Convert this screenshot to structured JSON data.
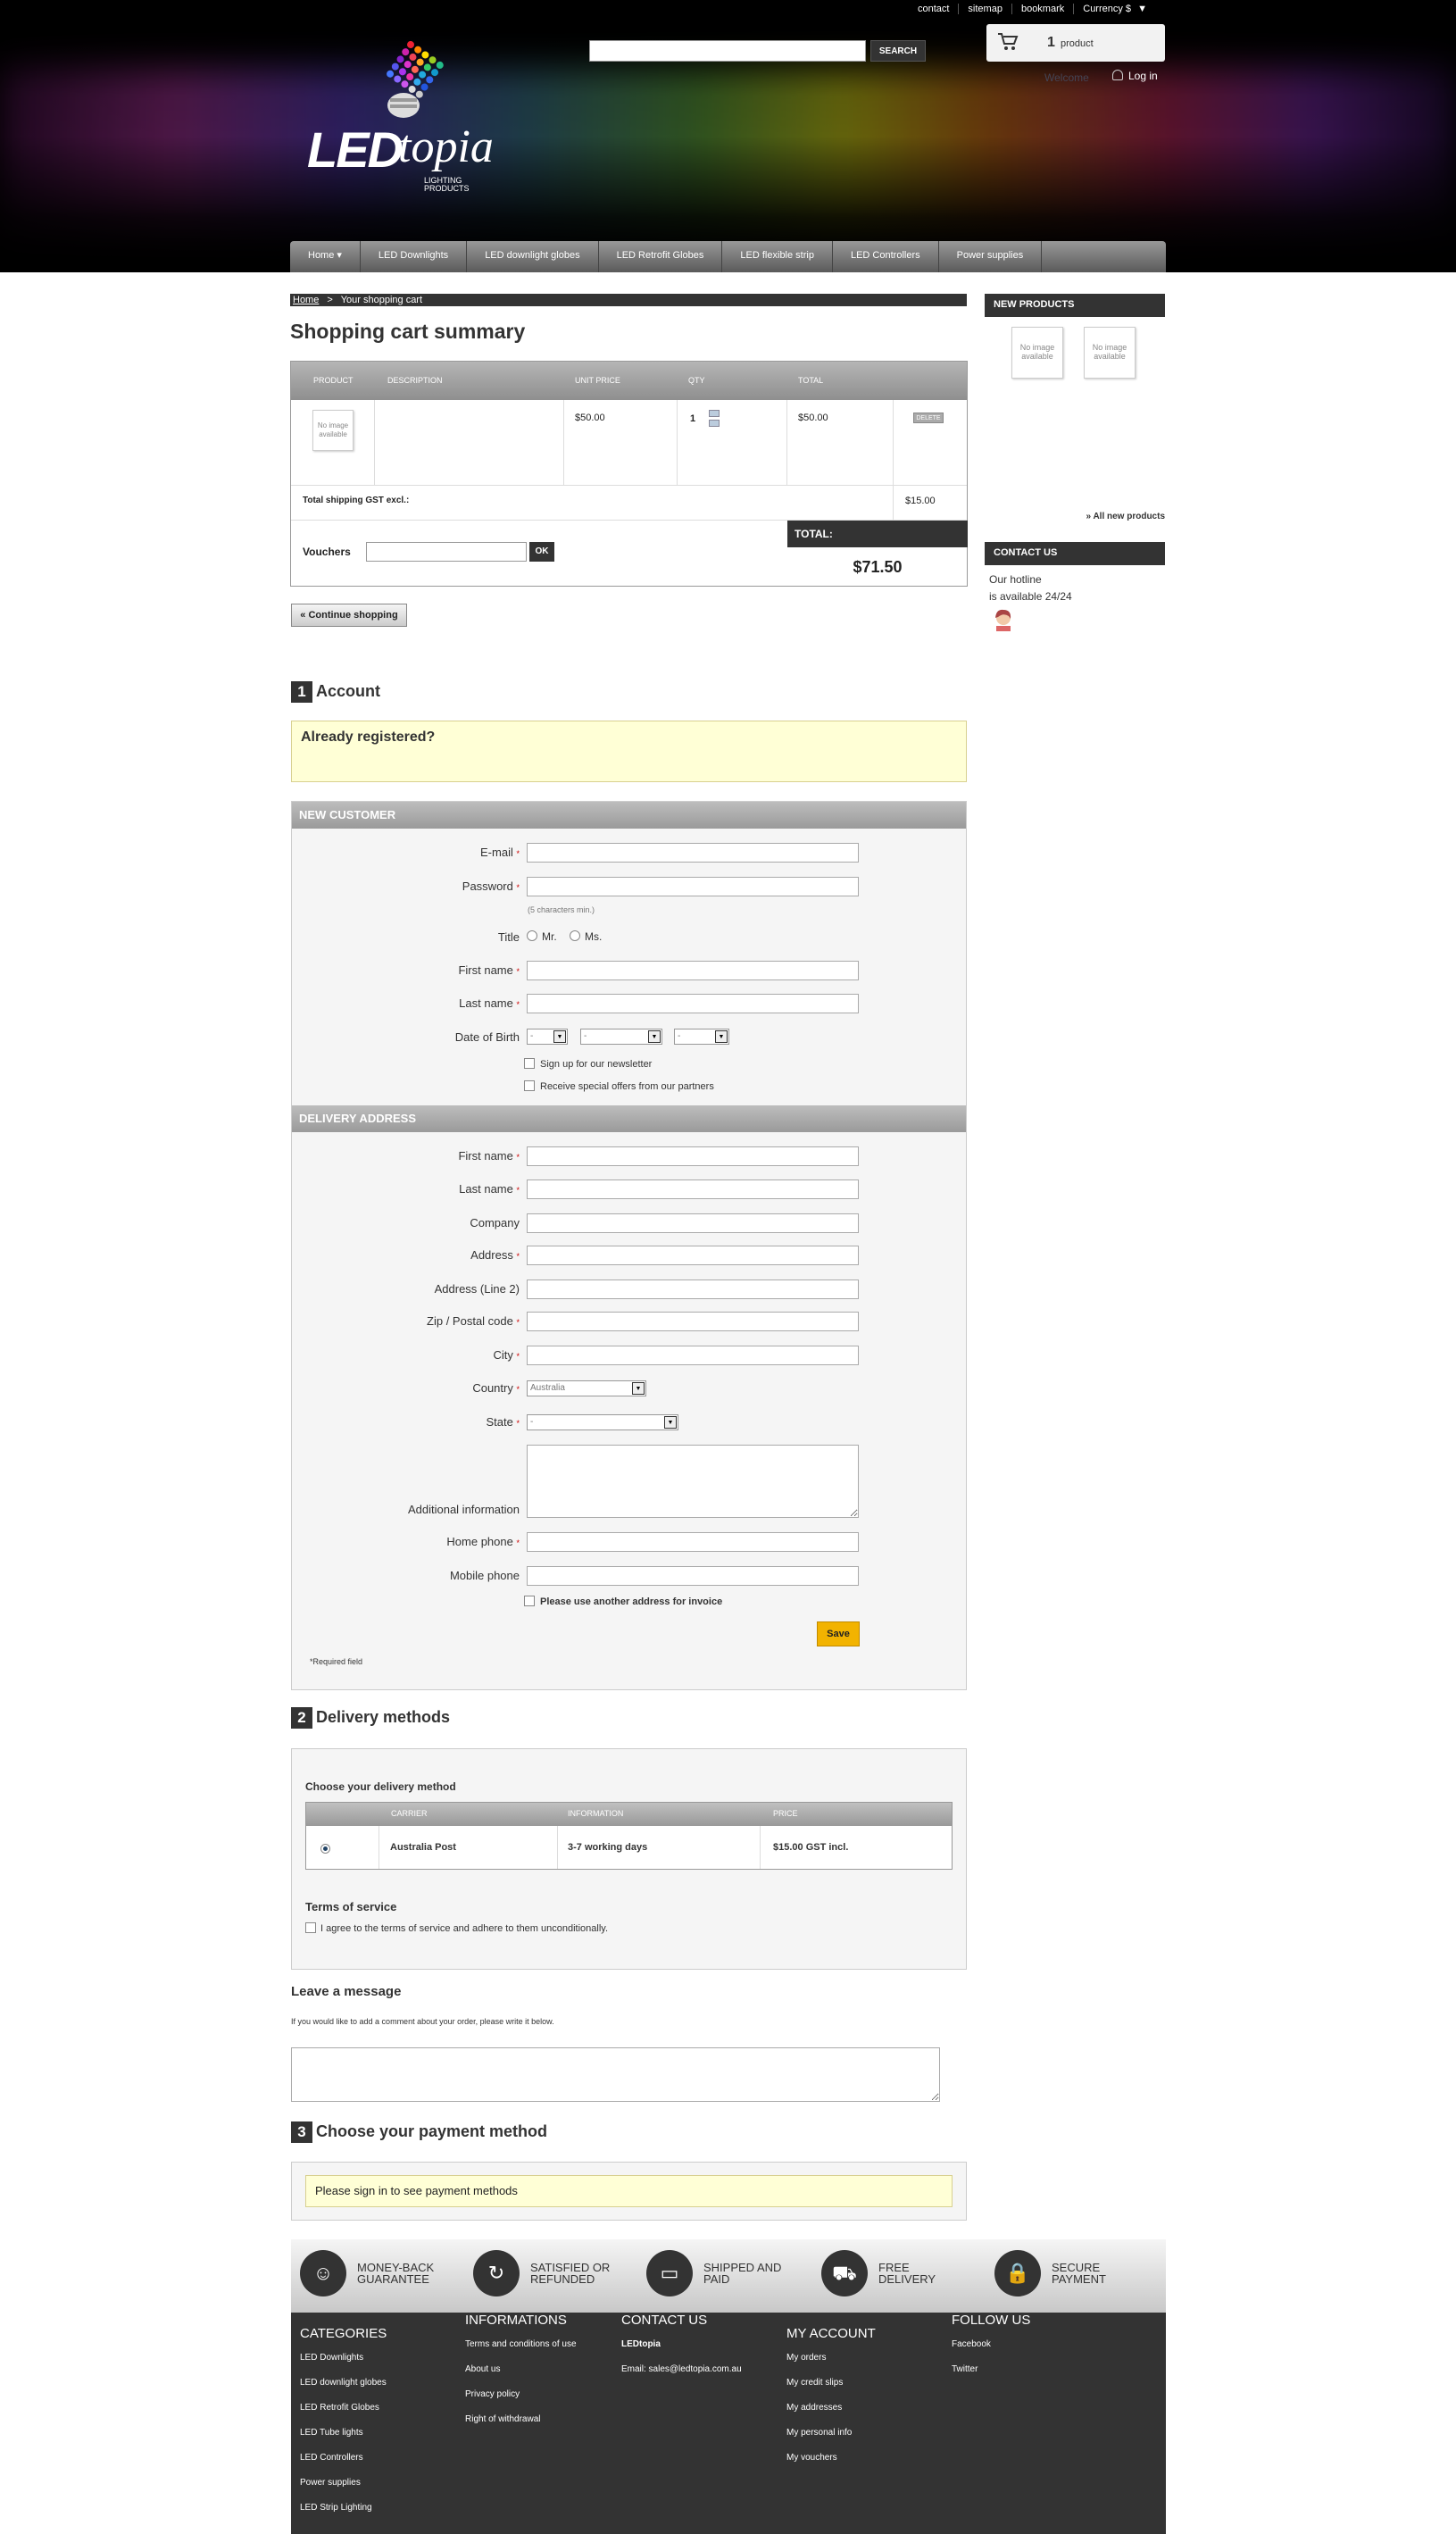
{
  "header": {
    "top_links": [
      "contact",
      "sitemap",
      "bookmark",
      "Currency $"
    ],
    "currency_arrow": "▼",
    "logo": {
      "led": "LED",
      "topia": "topia",
      "sub1": "LIGHTING",
      "sub2": "PRODUCTS"
    },
    "search": {
      "placeholder": "",
      "button": "SEARCH"
    },
    "cart": {
      "count": "1",
      "label": "product"
    },
    "welcome": "Welcome",
    "login": "Log in"
  },
  "nav": [
    "Home ▾",
    "LED Downlights",
    "LED downlight globes",
    "LED Retrofit Globes",
    "LED flexible strip",
    "LED Controllers",
    "Power supplies"
  ],
  "breadcrumb": {
    "home": "Home",
    "sep": ">",
    "current": "Your shopping cart"
  },
  "page_title": "Shopping cart summary",
  "cart_table": {
    "headers": [
      "PRODUCT",
      "DESCRIPTION",
      "UNIT PRICE",
      "QTY",
      "TOTAL"
    ],
    "row": {
      "no_image": "No image available",
      "unit_price": "$50.00",
      "qty": "1",
      "total": "$50.00",
      "delete": "DELETE"
    },
    "shipping_label": "Total shipping GST excl.:",
    "shipping_value": "$15.00",
    "vouchers_label": "Vouchers",
    "ok": "OK",
    "total_label": "TOTAL:",
    "total_value": "$71.50"
  },
  "continue_shopping": "« Continue shopping",
  "steps": {
    "account": {
      "num": "1",
      "title": "Account"
    },
    "delivery": {
      "num": "2",
      "title": "Delivery methods"
    },
    "payment": {
      "num": "3",
      "title": "Choose your payment method"
    }
  },
  "already_registered": "Already registered?",
  "new_customer": {
    "header": "NEW CUSTOMER",
    "email": "E-mail",
    "password": "Password",
    "password_hint": "(5 characters min.)",
    "title": "Title",
    "mr": "Mr.",
    "ms": "Ms.",
    "first_name": "First name",
    "last_name": "Last name",
    "dob": "Date of Birth",
    "dob_placeholder": "-",
    "newsletter": "Sign up for our newsletter",
    "offers": "Receive special offers from our partners",
    "req": "*"
  },
  "delivery_address": {
    "header": "DELIVERY ADDRESS",
    "first_name": "First name",
    "last_name": "Last name",
    "company": "Company",
    "address": "Address",
    "address2": "Address (Line 2)",
    "zip": "Zip / Postal code",
    "city": "City",
    "country": "Country",
    "country_value": "Australia",
    "state": "State",
    "state_value": "-",
    "additional": "Additional information",
    "home_phone": "Home phone",
    "mobile_phone": "Mobile phone",
    "invoice": "Please use another address for invoice",
    "save": "Save",
    "required": "*Required field"
  },
  "delivery_methods": {
    "choose": "Choose your delivery method",
    "headers": [
      "CARRIER",
      "INFORMATION",
      "PRICE"
    ],
    "carrier": "Australia Post",
    "info": "3-7 working days",
    "price": "$15.00 GST incl.",
    "terms_title": "Terms of service",
    "terms_text": "I agree to the terms of service and adhere to them unconditionally."
  },
  "message": {
    "title": "Leave a message",
    "hint": "If you would like to add a comment about your order, please write it below."
  },
  "payment_notice": "Please sign in to see payment methods",
  "sidebar": {
    "new_products": "NEW PRODUCTS",
    "no_image": "No image available",
    "all_new": "» All new products",
    "contact_us": "CONTACT US",
    "hotline1": "Our hotline",
    "hotline2": "is available 24/24"
  },
  "reassurance": [
    {
      "icon": "smile-icon",
      "text": "MONEY-BACK GUARANTEE"
    },
    {
      "icon": "refresh-icon",
      "text": "SATISFIED OR REFUNDED"
    },
    {
      "icon": "card-icon",
      "text": "SHIPPED AND PAID"
    },
    {
      "icon": "truck-icon",
      "text": "FREE DELIVERY"
    },
    {
      "icon": "lock-icon",
      "text": "SECURE PAYMENT"
    }
  ],
  "footer": {
    "categories": {
      "title": "CATEGORIES",
      "items": [
        "LED Downlights",
        "LED downlight globes",
        "LED Retrofit Globes",
        "LED Tube lights",
        "LED Controllers",
        "Power supplies",
        "LED Strip Lighting"
      ]
    },
    "informations": {
      "title": "INFORMATIONS",
      "items": [
        "Terms and conditions of use",
        "About us",
        "Privacy policy",
        "Right of withdrawal"
      ]
    },
    "contact": {
      "title": "CONTACT US",
      "company": "LEDtopia",
      "email": "Email: sales@ledtopia.com.au"
    },
    "account": {
      "title": "MY ACCOUNT",
      "items": [
        "My orders",
        "My credit slips",
        "My addresses",
        "My personal info",
        "My vouchers"
      ]
    },
    "follow": {
      "title": "FOLLOW US",
      "items": [
        "Facebook",
        "Twitter"
      ]
    }
  }
}
